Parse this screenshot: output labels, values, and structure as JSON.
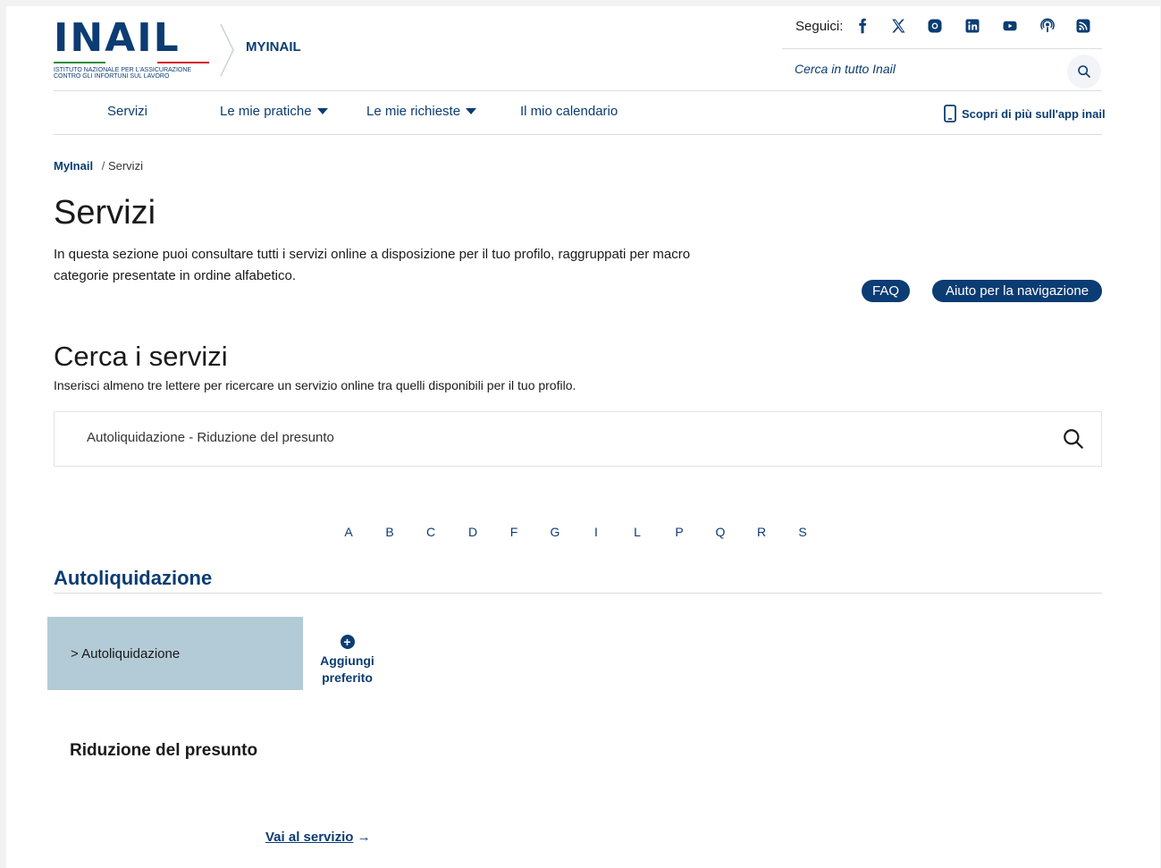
{
  "brand": {
    "logo_text": "INAIL",
    "logo_subtitle_1": "ISTITUTO NAZIONALE PER L'ASSICURAZIONE",
    "logo_subtitle_2": "CONTRO GLI INFORTUNI SUL LAVORO",
    "section": "MYINAIL",
    "colors": {
      "primary": "#0b3c73",
      "green": "#2e8b3c",
      "red": "#d0202a"
    }
  },
  "social": {
    "label": "Seguici:",
    "icons": [
      "facebook-icon",
      "x-icon",
      "instagram-icon",
      "linkedin-icon",
      "youtube-icon",
      "podcast-icon",
      "rss-icon"
    ]
  },
  "header_search": {
    "placeholder": "Cerca in tutto Inail"
  },
  "nav": {
    "items": [
      {
        "label": "Servizi"
      },
      {
        "label": "Le mie pratiche"
      },
      {
        "label": "Le mie richieste"
      },
      {
        "label": "Il mio calendario"
      }
    ],
    "app_link": "Scopri di più sull'app inail"
  },
  "breadcrumb": {
    "home": "MyInail",
    "separator": "/",
    "current": "Servizi"
  },
  "page": {
    "title": "Servizi",
    "intro": "In questa sezione puoi consultare tutti i servizi online a disposizione per il tuo profilo, raggruppati per macro categorie presentate in ordine alfabetico.",
    "faq": "FAQ",
    "help": "Aiuto per la navigazione"
  },
  "services_search": {
    "title": "Cerca i servizi",
    "hint": "Inserisci almeno tre lettere per ricercare un servizio online tra quelli disponibili per il tuo profilo.",
    "value": "Autoliquidazione - Riduzione del presunto"
  },
  "alphabet": [
    "A",
    "B",
    "C",
    "D",
    "F",
    "G",
    "I",
    "L",
    "P",
    "Q",
    "R",
    "S"
  ],
  "section": {
    "title": "Autoliquidazione",
    "card": {
      "category": "> Autoliquidazione",
      "fav_line1": "Aggiungi",
      "fav_line2": "preferito",
      "title": "Riduzione del presunto",
      "link": "Vai al servizio",
      "link_arrow": "→"
    }
  }
}
